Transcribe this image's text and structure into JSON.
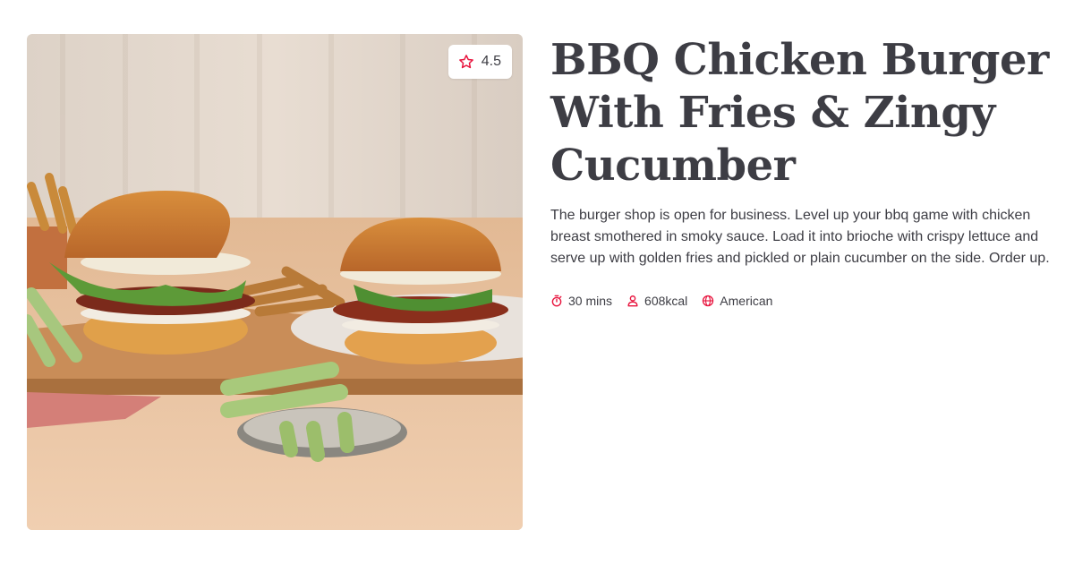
{
  "recipe": {
    "rating": "4.5",
    "title": "BBQ Chicken Burger With Fries & Zingy Cucumber",
    "description": "The burger shop is open for business. Level up your bbq game with chicken breast smothered in smoky sauce. Load it into brioche with crispy lettuce and serve up with golden fries and pickled or plain cucumber on the side. Order up.",
    "meta": {
      "time": "30 mins",
      "calories": "608kcal",
      "cuisine": "American"
    }
  },
  "colors": {
    "accent": "#e8163f",
    "text": "#3d3d44"
  },
  "icons": {
    "rating": "star-icon",
    "time": "stopwatch-icon",
    "calories": "person-icon",
    "cuisine": "globe-icon"
  }
}
